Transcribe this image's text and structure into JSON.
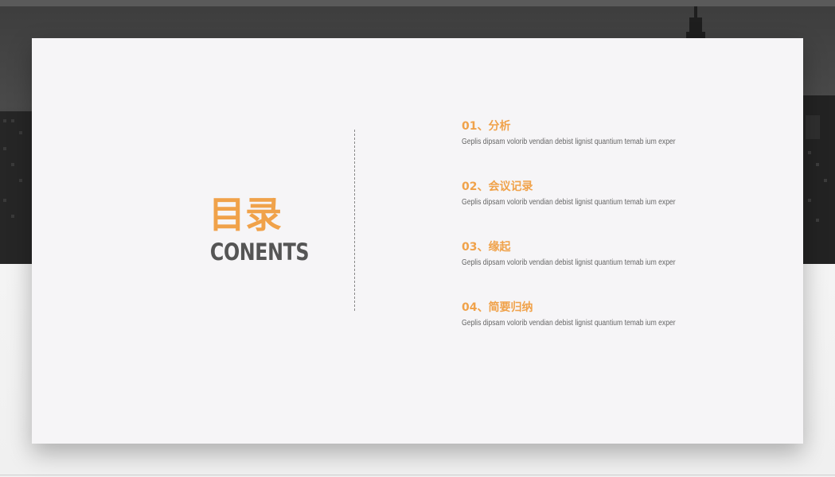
{
  "slide": {
    "title_cn": "目录",
    "title_en": "CONENTS"
  },
  "toc": {
    "items": [
      {
        "heading": "01、分析",
        "desc": "Geplis dipsam volorib vendian debist lignist quantium temab ium exper"
      },
      {
        "heading": "02、会议记录",
        "desc": "Geplis dipsam volorib vendian debist lignist quantium temab ium exper"
      },
      {
        "heading": "03、缘起",
        "desc": "Geplis dipsam volorib vendian debist lignist quantium temab ium exper"
      },
      {
        "heading": "04、简要归纳",
        "desc": "Geplis dipsam volorib vendian debist lignist quantium temab ium exper"
      }
    ]
  },
  "colors": {
    "accent": "#f0a24a",
    "title_gray": "#555555",
    "card_bg": "#f6f5f7",
    "backdrop": "#3d3d3d"
  }
}
